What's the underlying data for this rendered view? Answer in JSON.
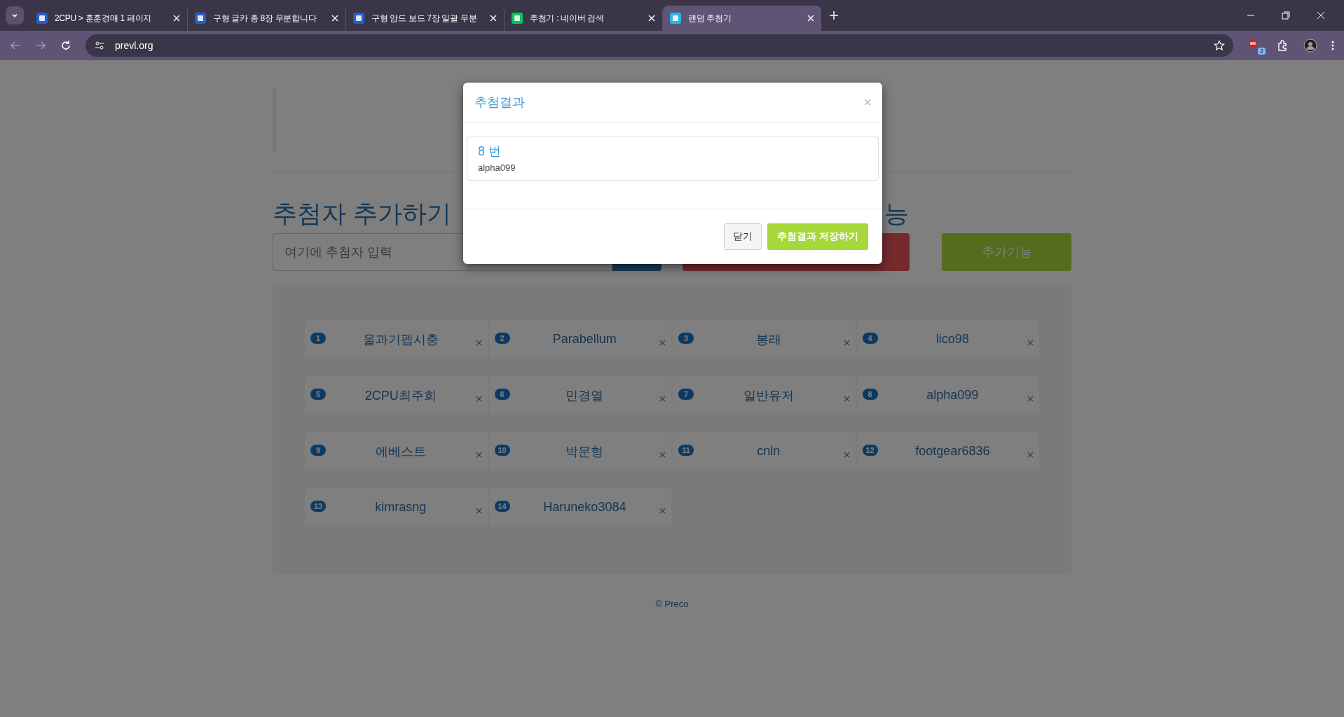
{
  "browser": {
    "tabs": [
      {
        "title": "2CPU > 훈훈경매 1 페이지",
        "selected": false,
        "kind": "blue"
      },
      {
        "title": "구형 글카 총 8장 무분합니다",
        "selected": false,
        "kind": "blue"
      },
      {
        "title": "구형 암드 보드 7장 일괄 무분",
        "selected": false,
        "kind": "blue"
      },
      {
        "title": "추첨기 : 네이버 검색",
        "selected": false,
        "kind": "green"
      },
      {
        "title": "랜덤 추첨기",
        "selected": true,
        "kind": "cyan"
      }
    ],
    "url": "prevl.org",
    "extension_badge": "2"
  },
  "page": {
    "add_heading": "추첨자 추가하기",
    "right_heading": "능",
    "input": {
      "placeholder": "여기에 추첨자 입력"
    },
    "extra_button": "추가기능",
    "entries": [
      {
        "number": "1",
        "name": "울과기펩시충"
      },
      {
        "number": "2",
        "name": "Parabellum"
      },
      {
        "number": "3",
        "name": "봉래"
      },
      {
        "number": "4",
        "name": "lico98"
      },
      {
        "number": "5",
        "name": "2CPU최주희"
      },
      {
        "number": "6",
        "name": "민경열"
      },
      {
        "number": "7",
        "name": "일반유저"
      },
      {
        "number": "8",
        "name": "alpha099"
      },
      {
        "number": "9",
        "name": "에베스트"
      },
      {
        "number": "10",
        "name": "박문형"
      },
      {
        "number": "11",
        "name": "cnln"
      },
      {
        "number": "12",
        "name": "footgear6836"
      },
      {
        "number": "13",
        "name": "kimrasng"
      },
      {
        "number": "14",
        "name": "Haruneko3084"
      }
    ],
    "footer": "© Preco"
  },
  "modal": {
    "title": "추첨결과",
    "result_number": "8 번",
    "result_name": "alpha099",
    "close_button": "닫기",
    "save_button": "추첨결과 저장하기"
  }
}
